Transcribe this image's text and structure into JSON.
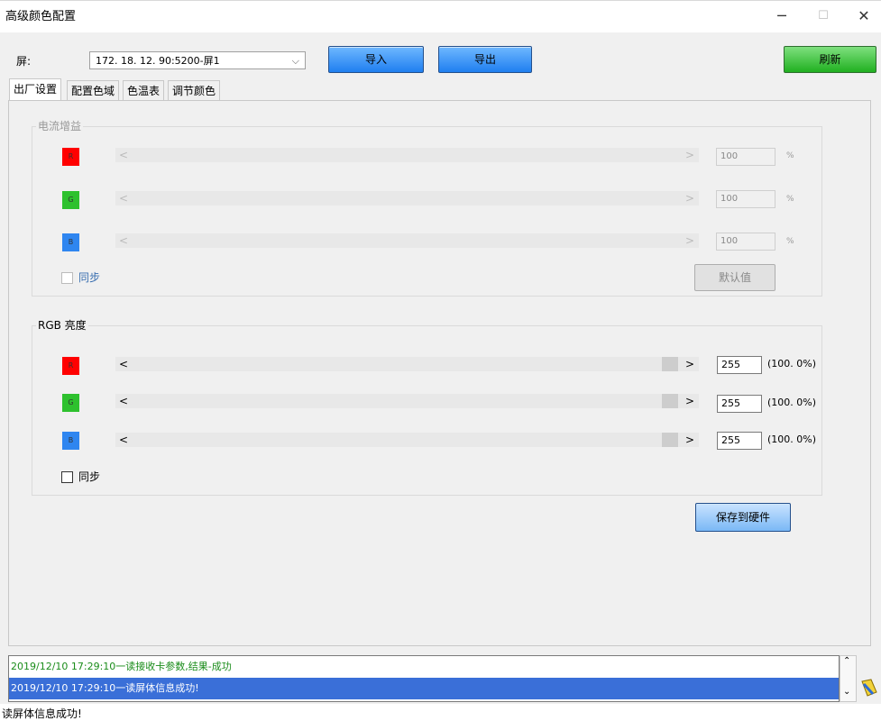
{
  "window": {
    "title": "高级颜色配置",
    "minimize_glyph": "─",
    "maximize_glyph": "☐",
    "close_glyph": "✕"
  },
  "toolbar": {
    "screen_label": "屏:",
    "screen_value": "172. 18. 12. 90:5200-屏1",
    "import_label": "导入",
    "export_label": "导出",
    "refresh_label": "刷新"
  },
  "tabs": [
    "出厂设置",
    "配置色域",
    "色温表",
    "调节颜色"
  ],
  "active_tab": 0,
  "current_gain": {
    "title": "电流增益",
    "enabled": false,
    "channels": [
      {
        "name": "R",
        "color": "#ff0000",
        "value": "100",
        "unit": "%"
      },
      {
        "name": "G",
        "color": "#2ec12e",
        "value": "100",
        "unit": "%"
      },
      {
        "name": "B",
        "color": "#2f86f0",
        "value": "100",
        "unit": "%"
      }
    ],
    "sync_label": "同步",
    "default_label": "默认值"
  },
  "rgb_brightness": {
    "title": "RGB 亮度",
    "enabled": true,
    "channels": [
      {
        "name": "R",
        "color": "#ff0000",
        "value": "255",
        "percent": "(100. 0%)",
        "level": 1.0
      },
      {
        "name": "G",
        "color": "#2ec12e",
        "value": "255",
        "percent": "(100. 0%)",
        "level": 1.0
      },
      {
        "name": "B",
        "color": "#2f86f0",
        "value": "255",
        "percent": "(100. 0%)",
        "level": 1.0
      }
    ],
    "sync_label": "同步"
  },
  "save_label": "保存到硬件",
  "log": [
    {
      "text": "2019/12/10 17:29:10一读接收卡参数,结果-成功",
      "color": "#1a8c1a",
      "selected": false
    },
    {
      "text": "2019/12/10 17:29:10一读屏体信息成功!",
      "color": "#ffffff",
      "selected": true
    }
  ],
  "status_text": "读屏体信息成功!",
  "colors": {
    "accent_blue": "#1f7ff0",
    "refresh_green": "#20b020",
    "log_selected_bg": "#3a6fd8"
  }
}
